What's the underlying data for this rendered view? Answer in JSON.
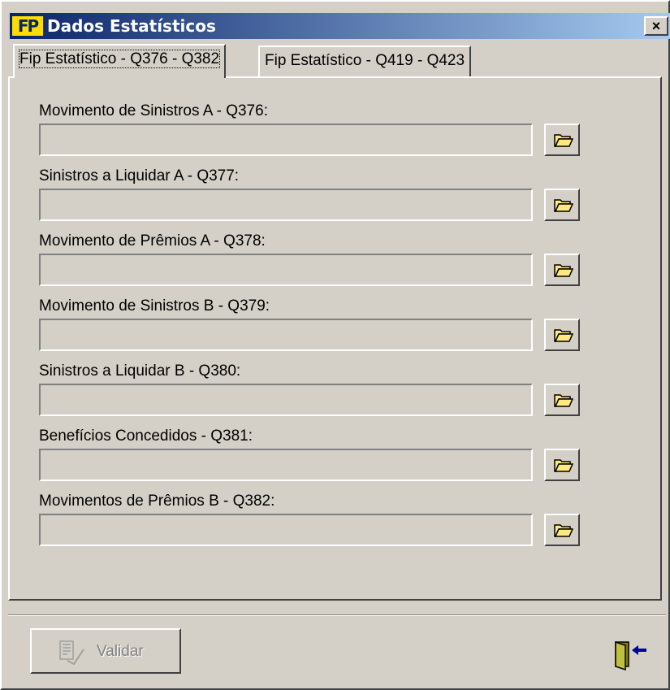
{
  "window": {
    "title": "Dados Estatísticos",
    "logo_text": "FP",
    "close_symbol": "×"
  },
  "tabs": [
    {
      "label": "Fip Estatístico - Q376 - Q382",
      "active": true
    },
    {
      "label": "Fip Estatístico - Q419 - Q423",
      "active": false
    }
  ],
  "fields": [
    {
      "label": "Movimento de Sinistros A - Q376:",
      "value": ""
    },
    {
      "label": "Sinistros a Liquidar A - Q377:",
      "value": ""
    },
    {
      "label": "Movimento de Prêmios A - Q378:",
      "value": ""
    },
    {
      "label": "Movimento de Sinistros B - Q379:",
      "value": ""
    },
    {
      "label": "Sinistros a Liquidar B - Q380:",
      "value": ""
    },
    {
      "label": "Benefícios Concedidos - Q381:",
      "value": ""
    },
    {
      "label": "Movimentos de Prêmios B - Q382:",
      "value": ""
    }
  ],
  "icons": {
    "browse": "folder-open-icon",
    "validar": "validate-document-icon",
    "exit": "exit-door-icon"
  },
  "footer": {
    "validar_label": "Validar",
    "validar_enabled": false
  },
  "colors": {
    "titlebar_start": "#0a246a",
    "titlebar_end": "#a6caf0",
    "face": "#d4d0c8",
    "folder": "#ffe880"
  }
}
